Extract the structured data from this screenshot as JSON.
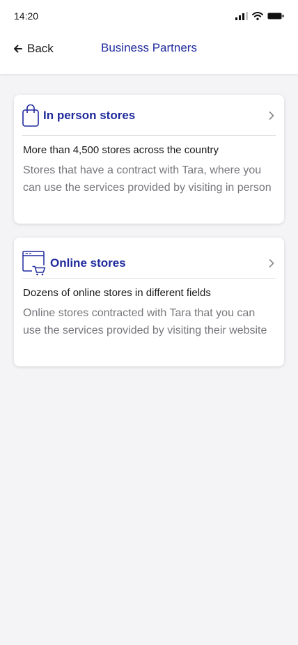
{
  "status_bar": {
    "time": "14:20",
    "icons": [
      "cellular-signal-icon",
      "wifi-icon",
      "battery-icon"
    ]
  },
  "header": {
    "back_label": "Back",
    "title": "Business Partners"
  },
  "cards": [
    {
      "icon": "shopping-bag-icon",
      "title": "In person stores",
      "subtitle": "More than 4,500 stores across the country",
      "description": "Stores that have a contract with Tara, where you can use the services provided by visiting in person"
    },
    {
      "icon": "browser-cart-icon",
      "title": "Online stores",
      "subtitle": "Dozens of online stores in different fields",
      "description": "Online stores contracted with Tara that you can use the services provided by visiting their website"
    }
  ],
  "colors": {
    "accent": "#1f2a9c",
    "background": "#f4f4f6",
    "card": "#ffffff",
    "muted_text": "#77777d"
  }
}
